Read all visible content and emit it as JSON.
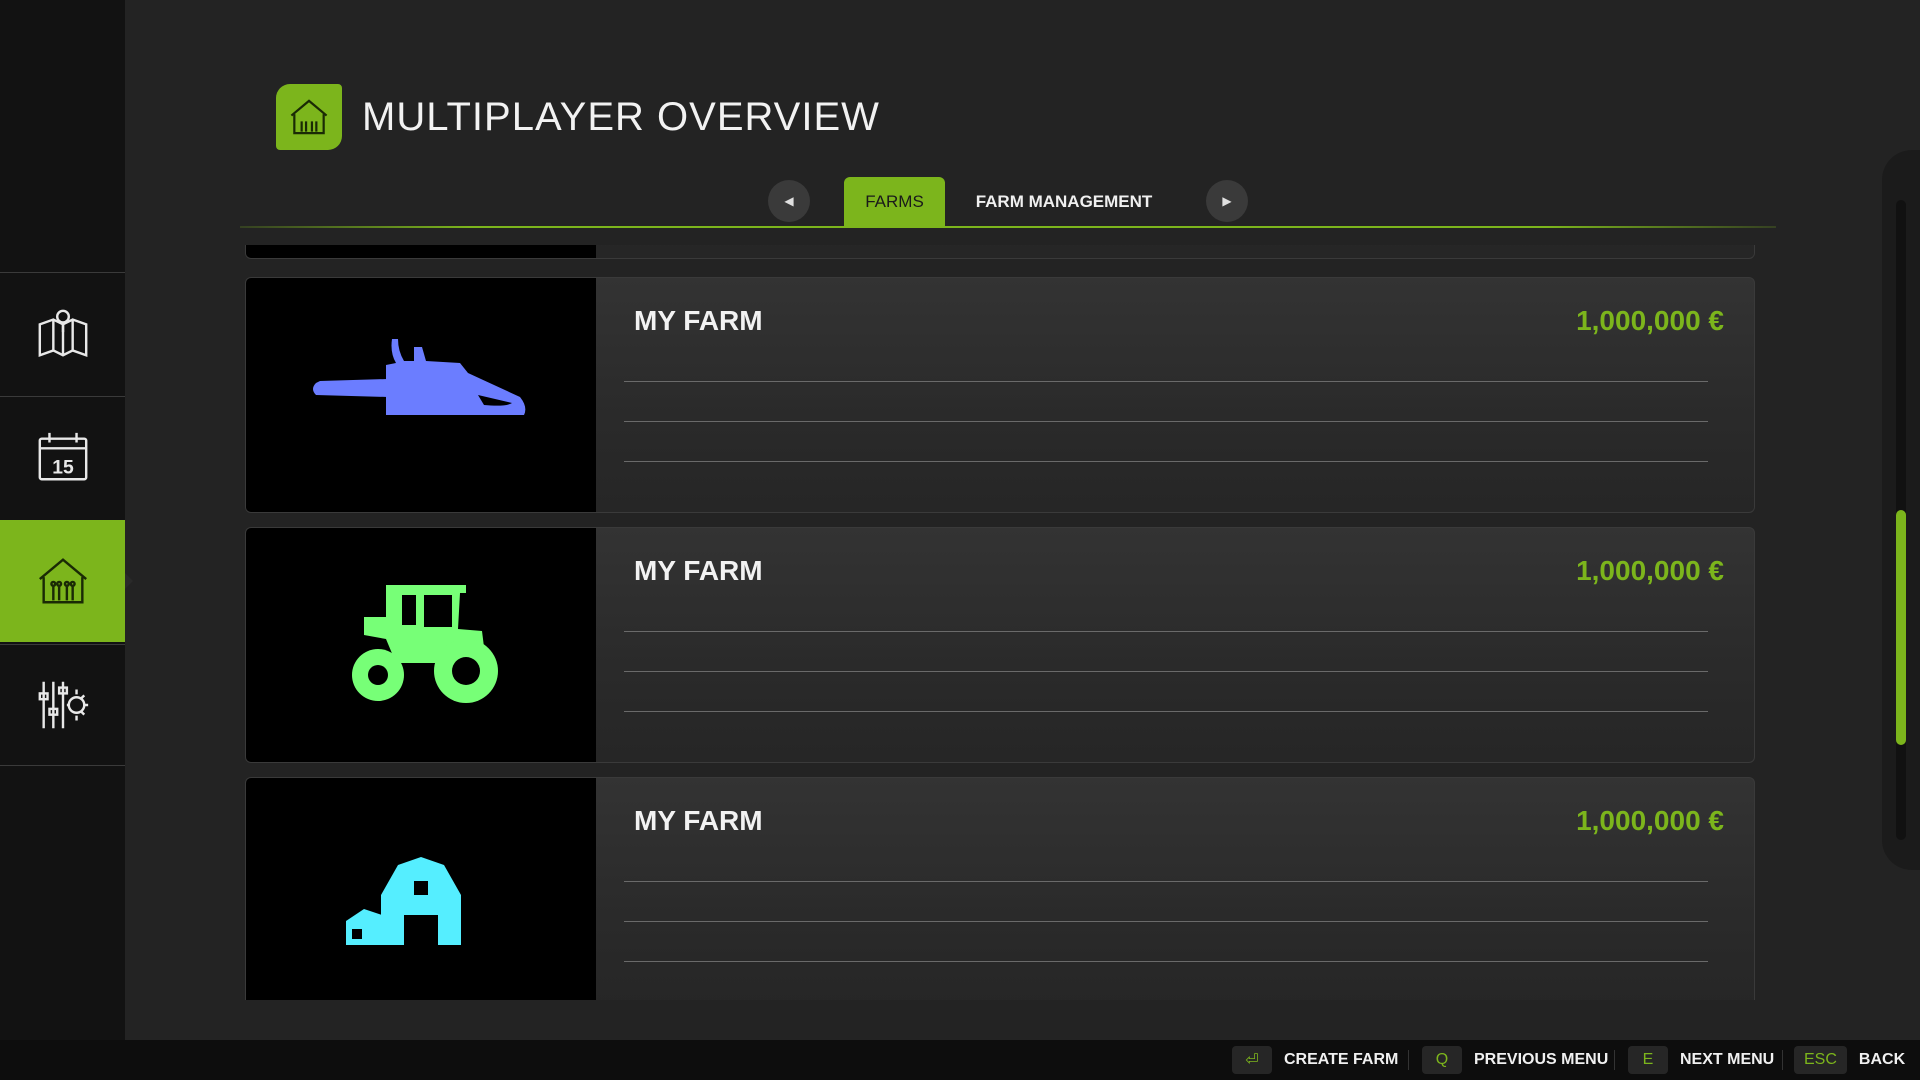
{
  "header": {
    "title": "MULTIPLAYER OVERVIEW",
    "icon": "barn-icon"
  },
  "tabs": [
    {
      "label": "FARMS",
      "active": true
    },
    {
      "label": "FARM MANAGEMENT",
      "active": false
    }
  ],
  "sidebar": {
    "items": [
      {
        "icon": "map-icon",
        "active": false
      },
      {
        "icon": "calendar-icon",
        "label": "15",
        "active": false
      },
      {
        "icon": "barn-icon",
        "active": true
      },
      {
        "icon": "settings-icon",
        "active": false
      }
    ]
  },
  "farms": [
    {
      "name": "MY FARM",
      "money": "1,000,000 €",
      "icon": "chainsaw-icon",
      "color": "#6b7dff"
    },
    {
      "name": "MY FARM",
      "money": "1,000,000 €",
      "icon": "tractor-icon",
      "color": "#77ff77"
    },
    {
      "name": "MY FARM",
      "money": "1,000,000 €",
      "icon": "barn-icon",
      "color": "#55eeff"
    }
  ],
  "footer": {
    "create": {
      "key": "⏎",
      "label": "CREATE FARM"
    },
    "previous": {
      "key": "Q",
      "label": "PREVIOUS MENU"
    },
    "next": {
      "key": "E",
      "label": "NEXT MENU"
    },
    "back": {
      "key": "ESC",
      "label": "BACK"
    }
  },
  "colors": {
    "accent": "#7cb51c",
    "background": "#232323",
    "sidebar": "#121212"
  }
}
